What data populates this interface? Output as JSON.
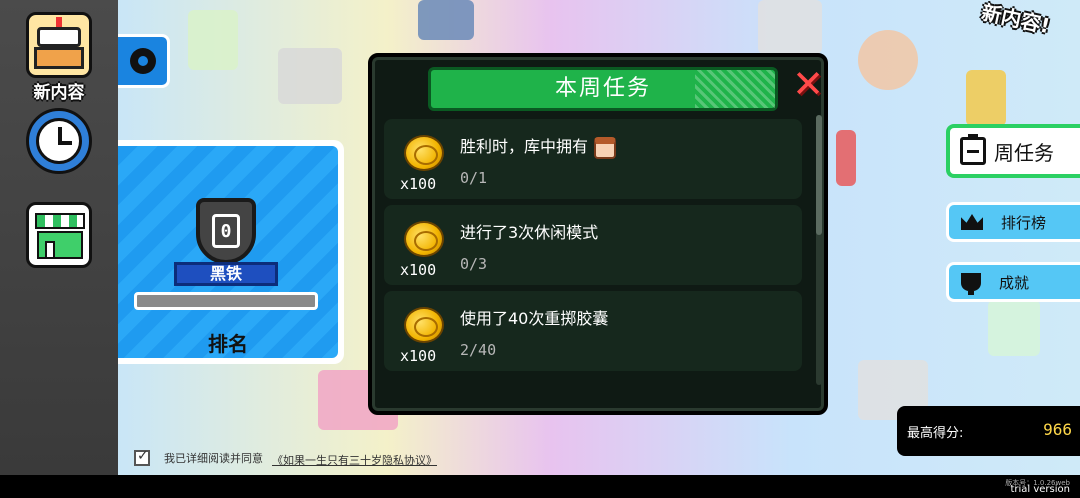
{
  "sidebar": {
    "new_content_label": "新内容"
  },
  "rank_card": {
    "rank_number": "0",
    "tier_name": "黑铁",
    "label": "排名"
  },
  "task_panel": {
    "title": "本周任务",
    "close_glyph": "✕",
    "tasks": [
      {
        "title": "胜利时，库中拥有",
        "reward": "x100",
        "progress": "0/1"
      },
      {
        "title": "进行了3次休闲模式",
        "reward": "x100",
        "progress": "0/3"
      },
      {
        "title": "使用了40次重掷胶囊",
        "reward": "x100",
        "progress": "2/40"
      }
    ]
  },
  "right_panel": {
    "new_content_badge": "新内容!",
    "weekly_task_button": "周任务",
    "leaderboard_button": "排行榜",
    "achievements_button": "成就"
  },
  "score": {
    "label": "最高得分:",
    "value": "966"
  },
  "consent": {
    "text": "我已详细阅读并同意",
    "link": "《如果一生只有三十岁隐私协议》"
  },
  "footer": {
    "version": "版本号：1.0.26web",
    "trial": "trial version"
  },
  "colors": {
    "accent_green": "#1fb34a",
    "panel_bg": "#0f1a14",
    "rank_blue": "#1f9bf0",
    "close_red": "#ff4a4a"
  }
}
